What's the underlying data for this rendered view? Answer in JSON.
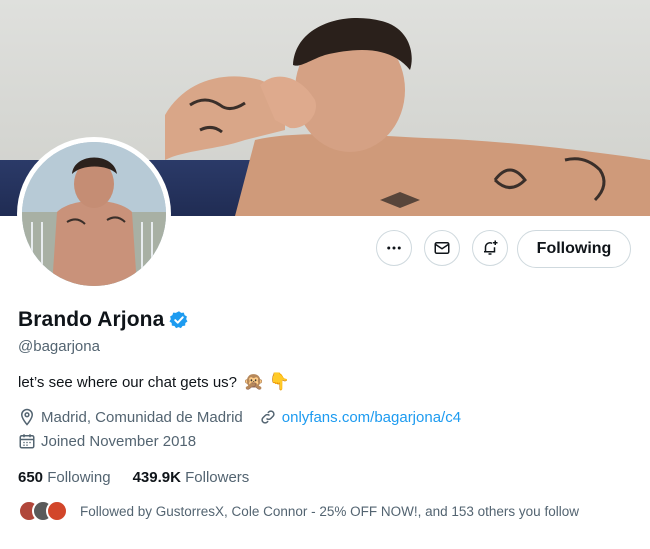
{
  "profile": {
    "name": "Brando Arjona",
    "handle": "@bagarjona",
    "bio": "let’s see where our chat gets us?",
    "bio_emojis": "🙊 👇",
    "location": "Madrid, Comunidad de Madrid",
    "website": "onlyfans.com/bagarjona/c4",
    "joined": "Joined November 2018",
    "verified": true,
    "verified_color": "#1d9bf0"
  },
  "actions": {
    "more_icon": "more-horizontal-icon",
    "message_icon": "envelope-icon",
    "notify_icon": "bell-plus-icon",
    "follow_label": "Following"
  },
  "stats": {
    "following_count": "650",
    "following_label": "Following",
    "followers_count": "439.9K",
    "followers_label": "Followers"
  },
  "followed_by": {
    "text": "Followed by GustorresX, Cole Connor - 25% OFF NOW!, and 153 others you follow"
  },
  "colors": {
    "text_primary": "#0f1419",
    "text_secondary": "#536471",
    "link": "#1d9bf0",
    "border": "#cfd9de"
  }
}
